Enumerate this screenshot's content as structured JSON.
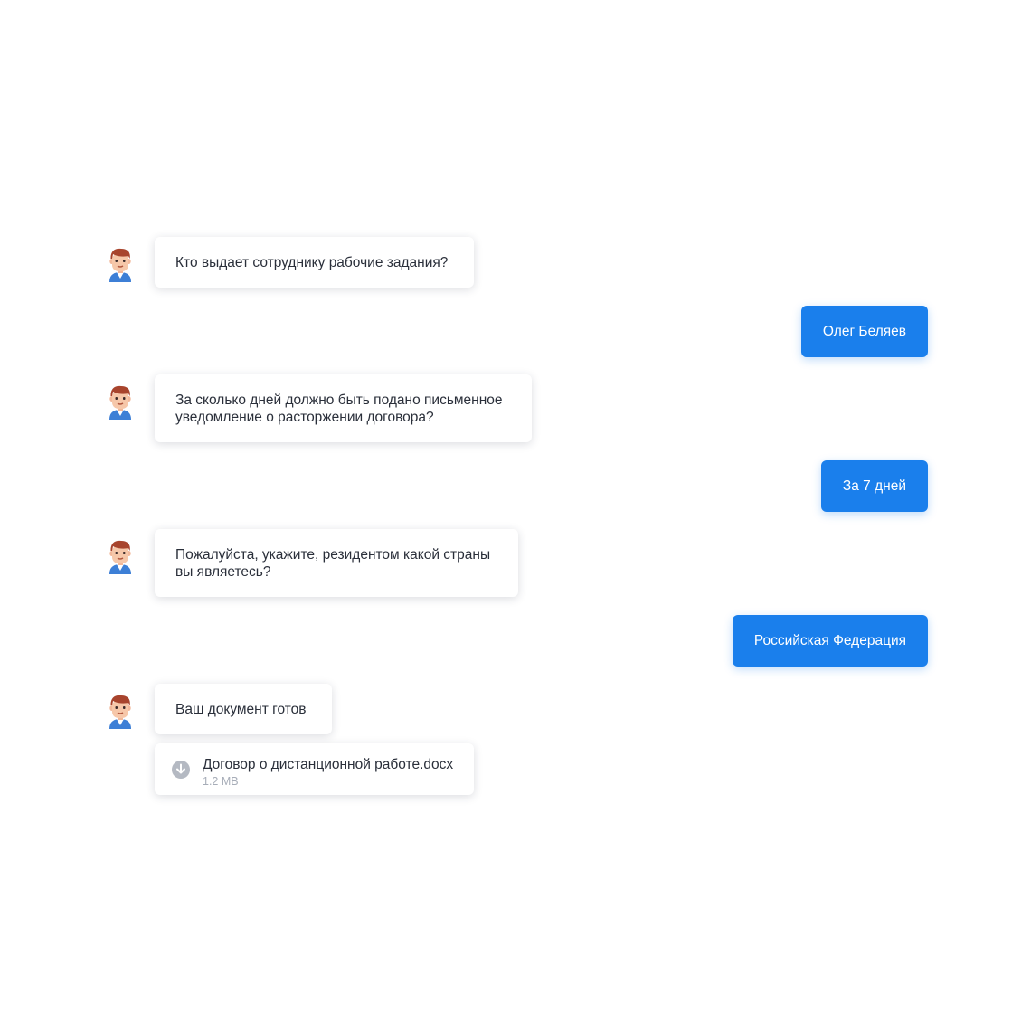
{
  "messages": {
    "bot_1": "Кто выдает сотруднику рабочие задания?",
    "user_1": "Олег Беляев",
    "bot_2_line1": "За сколько дней должно быть подано письменное",
    "bot_2_line2": "уведомление о расторжении договора?",
    "user_2": "За 7 дней",
    "bot_3_line1": "Пожалуйста, укажите, резидентом какой страны",
    "bot_3_line2": "вы являетесь?",
    "user_3": "Российская Федерация",
    "bot_4": "Ваш документ готов"
  },
  "attachment": {
    "file_name": "Договор о дистанционной работе.docx",
    "file_size": "1.2 MB",
    "icon": "download-icon"
  },
  "colors": {
    "user_bubble": "#1a7fec",
    "bot_bubble": "#ffffff",
    "text": "#2a2f3a",
    "muted": "#a7adb8",
    "icon_gray": "#b4b9c2"
  }
}
